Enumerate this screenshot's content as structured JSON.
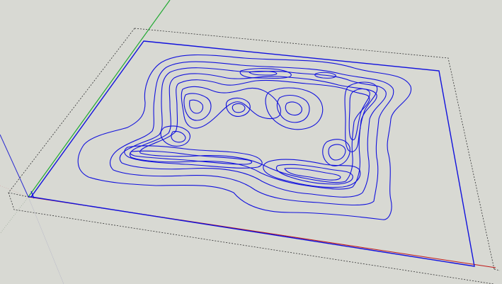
{
  "app": {
    "view": "3d-model-viewport"
  },
  "scene": {
    "background_color": "#d8d9d3",
    "model_stroke_color": "#1111dd",
    "bounding_box_color": "#222222",
    "axes": {
      "red_axis_color": "#cc1111",
      "green_axis_color": "#22aa33",
      "blue_axis_color": "#2222cc"
    },
    "objects": [
      "terrain-base-plane",
      "contour-lines",
      "bounding-box"
    ]
  }
}
